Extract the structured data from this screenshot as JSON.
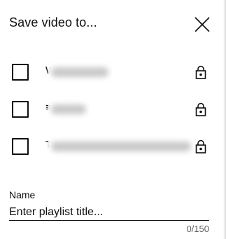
{
  "dialog": {
    "title": "Save video to...",
    "close_icon": "close-icon",
    "playlists": [
      {
        "label_prefix": "W",
        "checked": false,
        "privacy_icon": "lock-icon"
      },
      {
        "label_prefix": "≡",
        "checked": false,
        "privacy_icon": "lock-icon"
      },
      {
        "label_prefix": "T",
        "checked": false,
        "privacy_icon": "lock-icon"
      }
    ],
    "new_playlist": {
      "name_label": "Name",
      "placeholder": "Enter playlist title...",
      "value": "",
      "counter": "0/150"
    }
  }
}
